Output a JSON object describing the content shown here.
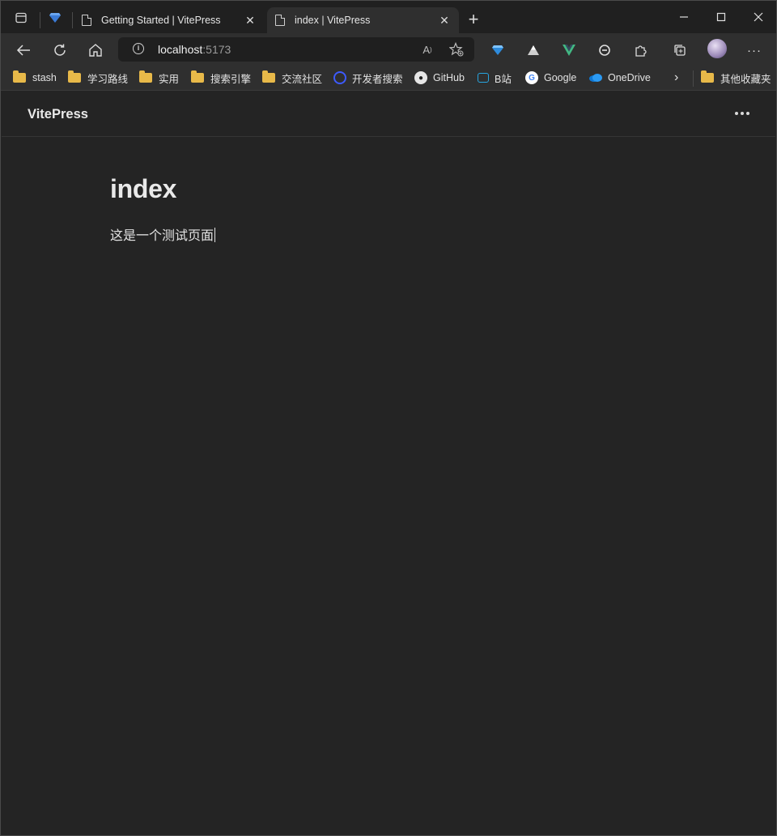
{
  "browser": {
    "tabs": [
      {
        "title": "Getting Started | VitePress",
        "active": false
      },
      {
        "title": "index | VitePress",
        "active": true
      }
    ],
    "close_glyph": "✕",
    "address": {
      "host": "localhost",
      "port": ":5173"
    },
    "bookmarks": [
      {
        "label": "stash",
        "icon": "folder-icon"
      },
      {
        "label": "学习路线",
        "icon": "folder-icon"
      },
      {
        "label": "实用",
        "icon": "folder-icon"
      },
      {
        "label": "搜索引擎",
        "icon": "folder-icon"
      },
      {
        "label": "交流社区",
        "icon": "folder-icon"
      },
      {
        "label": "开发者搜索",
        "icon": "devsearch-icon"
      },
      {
        "label": "GitHub",
        "icon": "github-icon"
      },
      {
        "label": "B站",
        "icon": "bilibili-icon"
      },
      {
        "label": "Google",
        "icon": "google-icon"
      },
      {
        "label": "OneDrive",
        "icon": "onedrive-icon"
      }
    ],
    "other_bookmarks": "其他收藏夹",
    "colors": {
      "accent_vue": "#42b883",
      "folder": "#e8b949",
      "background": "#242424"
    }
  },
  "page": {
    "brand": "VitePress",
    "heading": "index",
    "body_text": "这是一个测试页面"
  }
}
